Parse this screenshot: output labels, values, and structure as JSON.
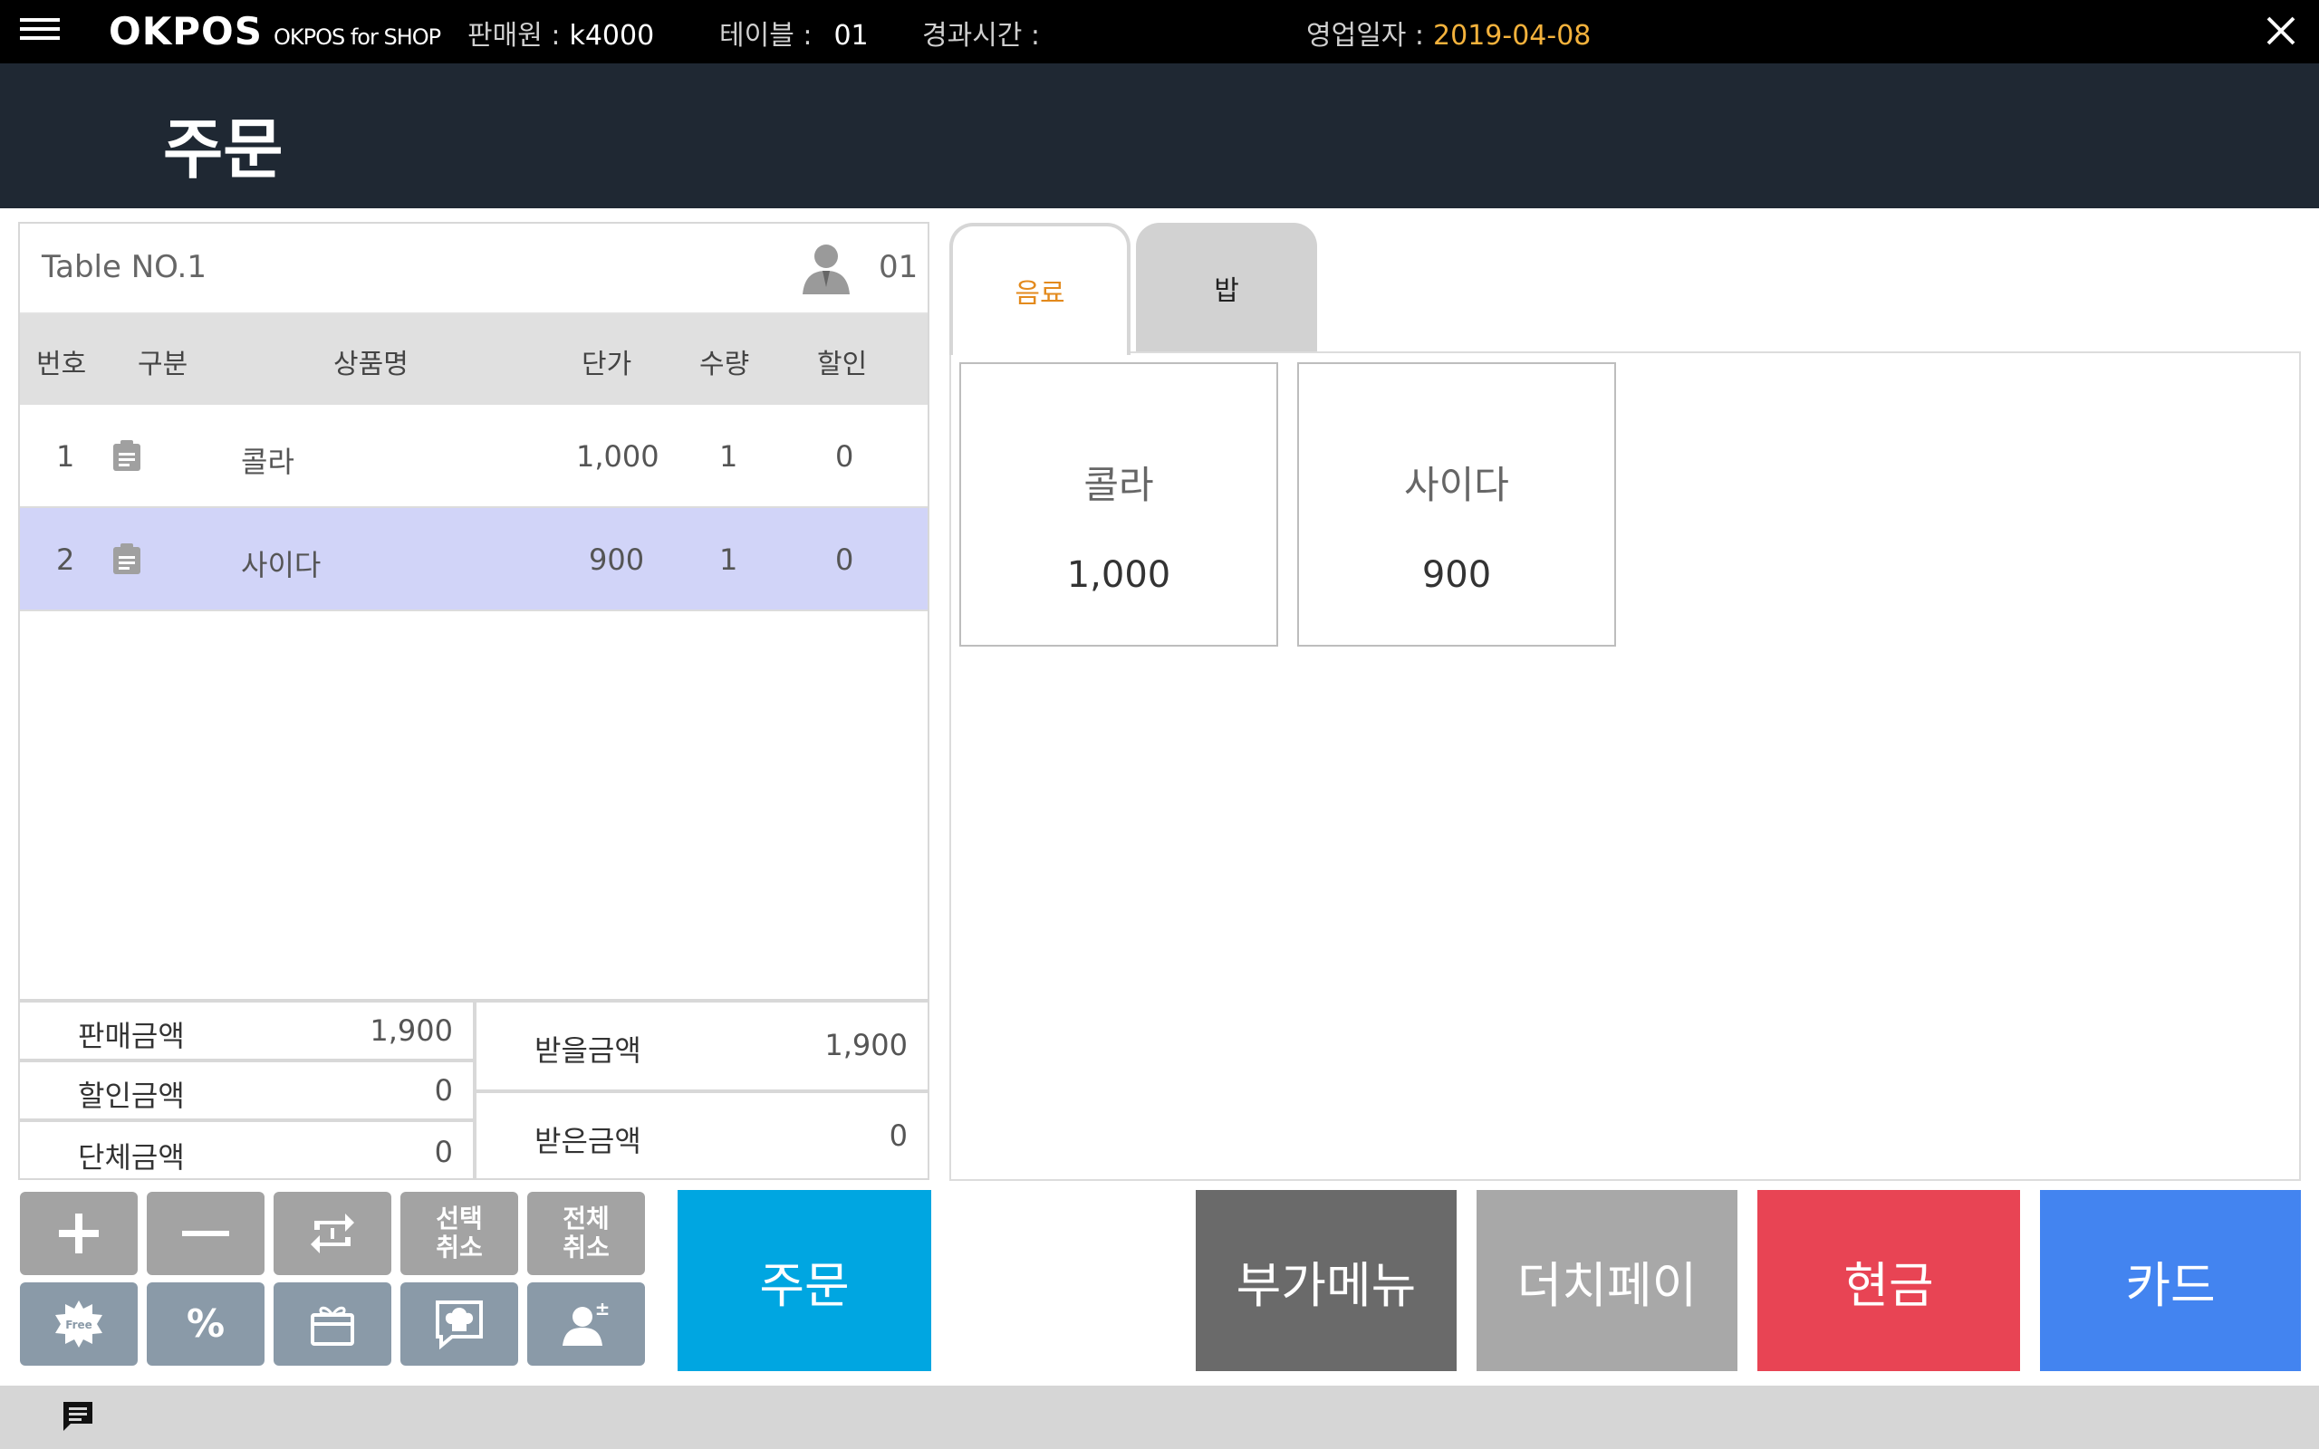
{
  "topbar": {
    "logo": "OKPOS",
    "logo_sub": "OKPOS for SHOP",
    "seller_label": "판매원 :",
    "seller_value": "k4000",
    "table_label": "테이블 :",
    "table_value": "01",
    "elapsed_label": "경과시간 :",
    "business_date_label": "영업일자 :",
    "business_date_value": "2019-04-08",
    "icons": [
      "hamburger-menu-icon",
      "close-icon"
    ]
  },
  "title": "주문",
  "order_panel": {
    "table_name": "Table NO.1",
    "guest_count": "01",
    "columns": [
      "번호",
      "구분",
      "상품명",
      "단가",
      "수량",
      "할인"
    ],
    "rows": [
      {
        "no": "1",
        "name": "콜라",
        "price": "1,000",
        "qty": "1",
        "discount": "0",
        "selected": false
      },
      {
        "no": "2",
        "name": "사이다",
        "price": "900",
        "qty": "1",
        "discount": "0",
        "selected": true
      }
    ]
  },
  "summary": {
    "sale_label": "판매금액",
    "sale_value": "1,900",
    "discount_label": "할인금액",
    "discount_value": "0",
    "group_label": "단체금액",
    "group_value": "0",
    "receivable_label": "받을금액",
    "receivable_value": "1,900",
    "received_label": "받은금액",
    "received_value": "0"
  },
  "tools": {
    "select_cancel": "선택\n취소",
    "all_cancel": "전체\n취소",
    "icons": [
      "plus-icon",
      "minus-icon",
      "swap-icon",
      "free-badge-icon",
      "percent-icon",
      "gift-card-icon",
      "chef-message-icon",
      "customer-add-icon"
    ]
  },
  "order_button": "주문",
  "menu": {
    "tabs": [
      {
        "label": "음료",
        "active": true
      },
      {
        "label": "밥",
        "active": false
      }
    ],
    "items": [
      {
        "name": "콜라",
        "price": "1,000"
      },
      {
        "name": "사이다",
        "price": "900"
      }
    ]
  },
  "payment": {
    "extra_menu": "부가메뉴",
    "dutch_pay": "더치페이",
    "cash": "현금",
    "card": "카드"
  },
  "colors": {
    "accent_blue": "#00a6e1",
    "cash_red": "#e84454",
    "card_blue": "#4384f0",
    "extra_gray": "#6a6a6a",
    "dutch_gray": "#a8a8a8",
    "date_orange": "#f4b23c",
    "tab_orange": "#e38a1d",
    "selected_row": "#d1d4f8"
  }
}
